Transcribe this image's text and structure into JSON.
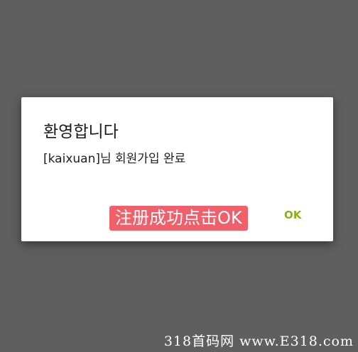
{
  "dialog": {
    "title": "환영합니다",
    "message": "[kaixuan]님 회원가입 완료",
    "annotation": "注册成功点击OK",
    "ok_label": "OK"
  },
  "watermark": "318首码网 www.E318.com",
  "colors": {
    "backdrop": "#5f5f5f",
    "dialog_bg": "#ffffff",
    "annotation_bg": "#f0606a",
    "ok_text": "#8ab416"
  }
}
